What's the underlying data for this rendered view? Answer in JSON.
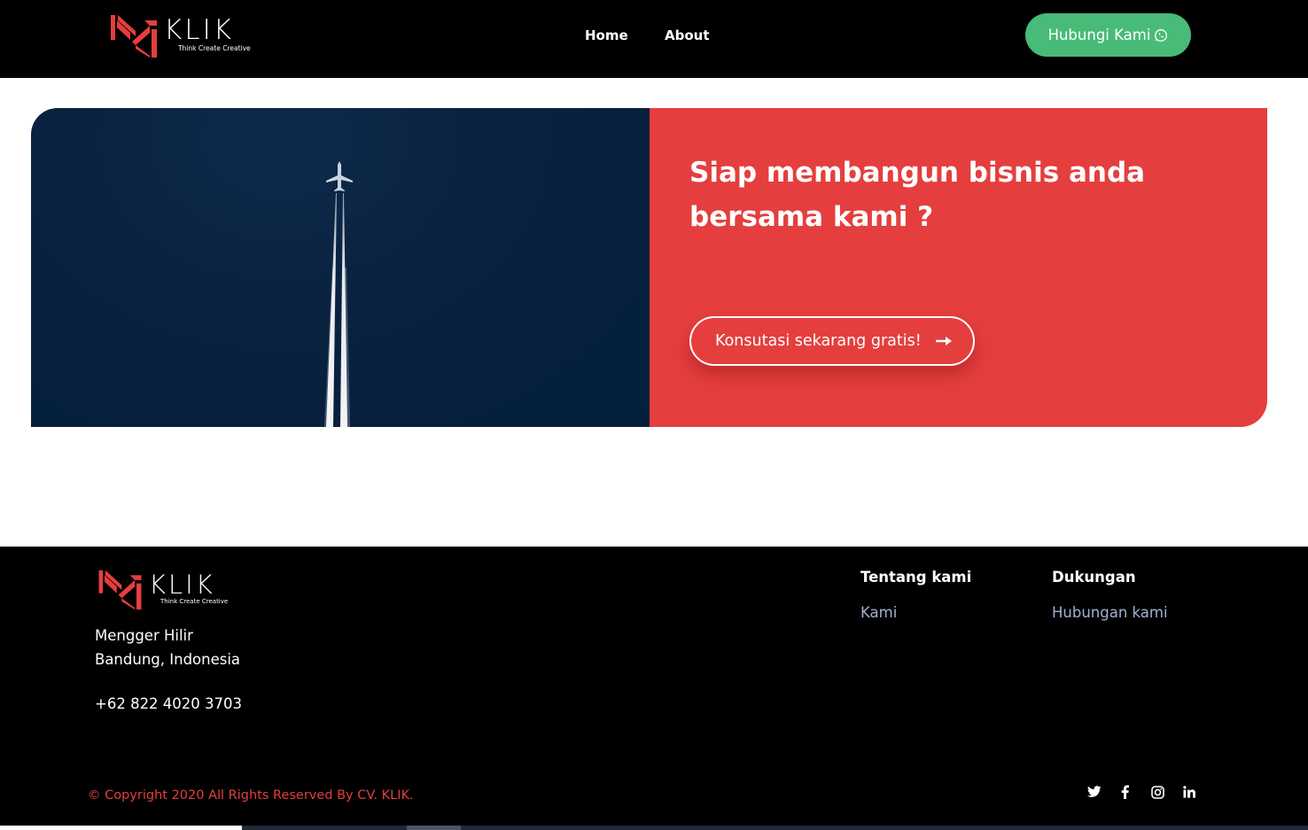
{
  "brand": {
    "name": "KLIK",
    "tagline": "Think Create Creative",
    "accent_color": "#e53e3e",
    "green_color": "#48bb78"
  },
  "navbar": {
    "links": [
      {
        "label": "Home"
      },
      {
        "label": "About"
      }
    ],
    "contact_button": {
      "label": "Hubungi Kami",
      "icon": "whatsapp-icon"
    }
  },
  "hero": {
    "image_alt_icon": "airplane-contrail-photo",
    "title": "Siap membangun bisnis anda bersama kami ?",
    "cta_label": "Konsutasi sekarang gratis!",
    "cta_icon": "arrow-right-icon"
  },
  "footer": {
    "address_line1": "Mengger Hilir",
    "address_line2": "Bandung, Indonesia",
    "phone": "+62 822 4020 3703",
    "columns": [
      {
        "heading": "Tentang kami",
        "links": [
          "Kami"
        ]
      },
      {
        "heading": "Dukungan",
        "links": [
          "Hubungan kami"
        ]
      }
    ],
    "copyright": "© Copyright 2020 All Rights Reserved By CV. KLIK.",
    "social_icons": [
      "twitter-icon",
      "facebook-icon",
      "instagram-icon",
      "linkedin-icon"
    ]
  }
}
